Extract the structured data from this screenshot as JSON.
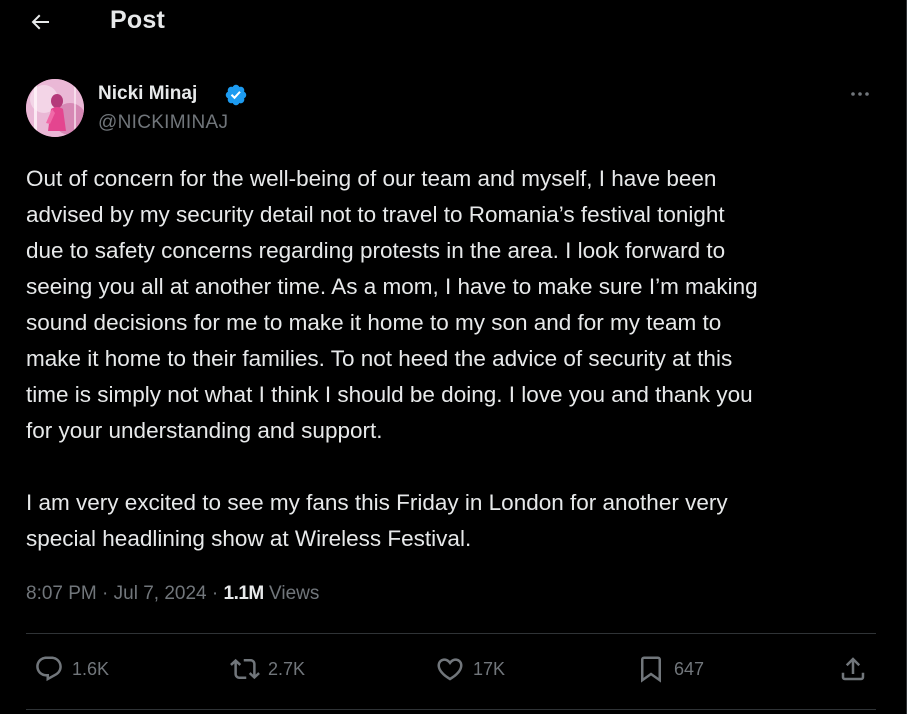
{
  "header": {
    "title": "Post",
    "back_icon": "arrow-left-icon"
  },
  "author": {
    "name": "Nicki Minaj",
    "handle": "@NICKIMINAJ",
    "verified": true,
    "verified_color": "#1d9bf0"
  },
  "post": {
    "text": "Out of concern for the well-being of our team and myself, I have been\nadvised by my security detail not to travel to Romania’s festival tonight\ndue to safety concerns regarding protests in the area. I look forward to\nseeing you all at another time. As a mom, I have to make sure I’m making\nsound decisions for me to make it home to my son and for my team to\nmake it home to their families. To not heed the advice of security at this\ntime is simply not what I think I should be doing. I love you and thank you\nfor your understanding and support.\n\nI am very excited to see my fans this Friday in London for another very\nspecial headlining show at Wireless Festival.",
    "time": "8:07 PM",
    "separator": "·",
    "date": "Jul 7, 2024",
    "views_count": "1.1M",
    "views_label": "Views"
  },
  "actions": {
    "replies": "1.6K",
    "reposts": "2.7K",
    "likes": "17K",
    "bookmarks": "647"
  },
  "colors": {
    "background": "#000000",
    "text": "#e7e9ea",
    "muted": "#71767b",
    "border": "#2f3336",
    "accent": "#1d9bf0"
  }
}
